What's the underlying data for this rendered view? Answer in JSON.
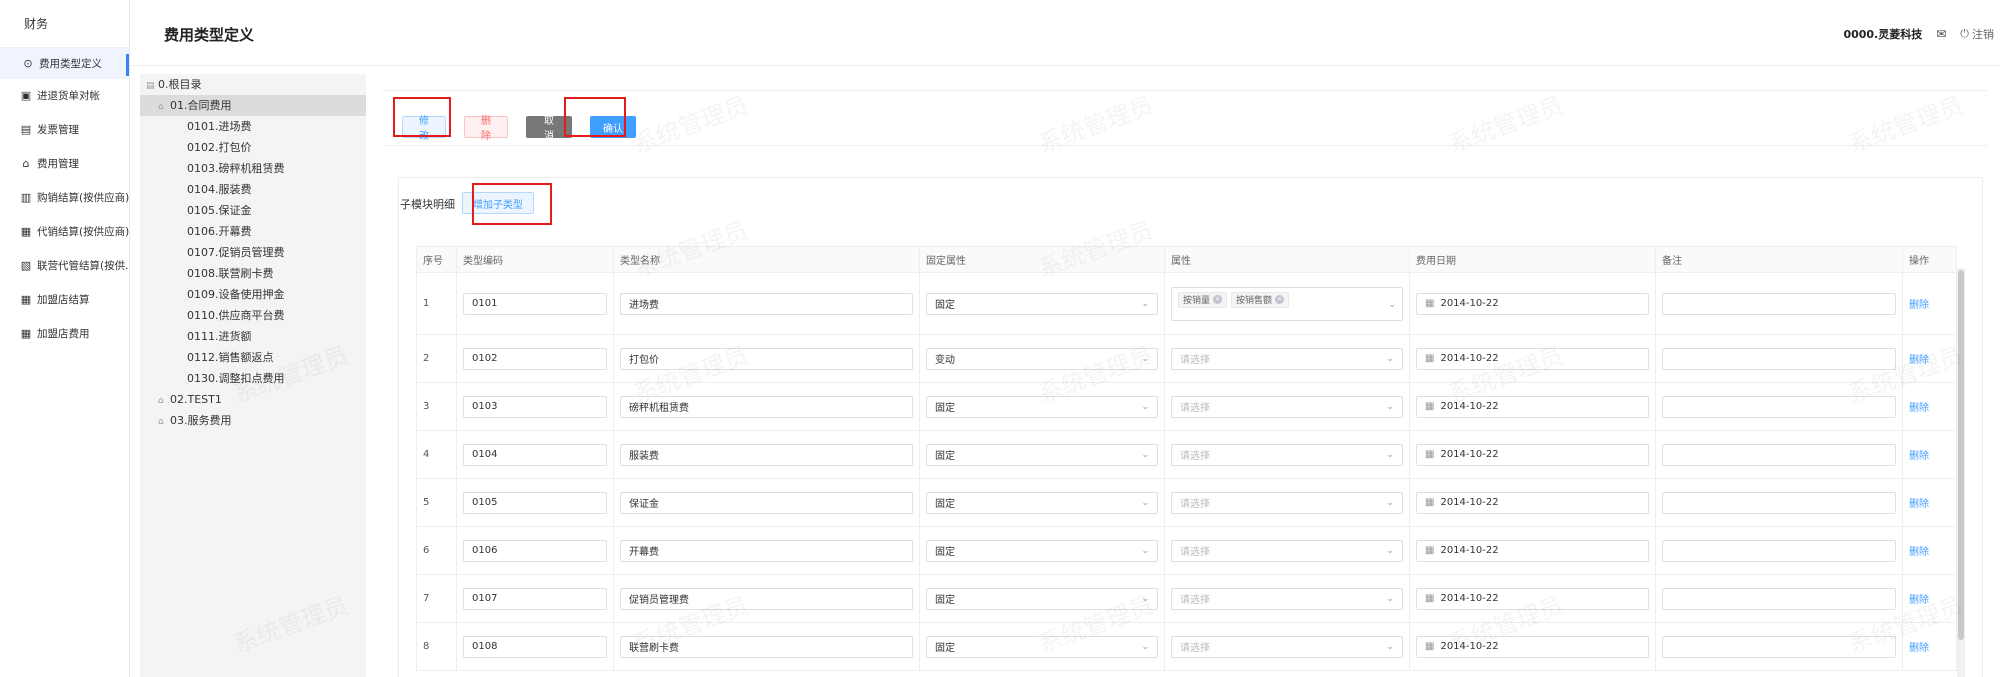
{
  "nav": {
    "title": "财务",
    "items": [
      {
        "label": "费用类型定义",
        "icon": "circle-icon"
      },
      {
        "label": "进退货单对帐",
        "icon": "calendar-icon"
      },
      {
        "label": "发票管理",
        "icon": "invoice-icon"
      },
      {
        "label": "费用管理",
        "icon": "home-icon"
      },
      {
        "label": "购销结算(按供应商)",
        "icon": "bar-chart-icon"
      },
      {
        "label": "代销结算(按供应商)",
        "icon": "grid-icon"
      },
      {
        "label": "联营代管结算(按供...",
        "icon": "document-icon"
      },
      {
        "label": "加盟店结算",
        "icon": "grid-icon"
      },
      {
        "label": "加盟店费用",
        "icon": "grid-icon"
      }
    ]
  },
  "header": {
    "title": "费用类型定义",
    "company": "0000.灵菱科技",
    "logout": "注销"
  },
  "tree": [
    {
      "label": "0.根目录",
      "level": 0,
      "selected": false
    },
    {
      "label": "01.合同费用",
      "level": 1,
      "selected": true
    },
    {
      "label": "0101.进场费",
      "level": 2,
      "selected": false
    },
    {
      "label": "0102.打包价",
      "level": 2,
      "selected": false
    },
    {
      "label": "0103.磅秤机租赁费",
      "level": 2,
      "selected": false
    },
    {
      "label": "0104.服装费",
      "level": 2,
      "selected": false
    },
    {
      "label": "0105.保证金",
      "level": 2,
      "selected": false
    },
    {
      "label": "0106.开幕费",
      "level": 2,
      "selected": false
    },
    {
      "label": "0107.促销员管理费",
      "level": 2,
      "selected": false
    },
    {
      "label": "0108.联营刷卡费",
      "level": 2,
      "selected": false
    },
    {
      "label": "0109.设备使用押金",
      "level": 2,
      "selected": false
    },
    {
      "label": "0110.供应商平台费",
      "level": 2,
      "selected": false
    },
    {
      "label": "0111.进货额",
      "level": 2,
      "selected": false
    },
    {
      "label": "0112.销售额返点",
      "level": 2,
      "selected": false
    },
    {
      "label": "0130.调整扣点费用",
      "level": 2,
      "selected": false
    },
    {
      "label": "02.TEST1",
      "level": 1,
      "selected": false
    },
    {
      "label": "03.服务费用",
      "level": 1,
      "selected": false
    }
  ],
  "toolbar": {
    "edit": "修改",
    "delete": "删除",
    "cancel": "取 消",
    "confirm": "确认"
  },
  "sub": {
    "label": "子模块明细",
    "add_button": "增加子类型"
  },
  "table": {
    "headers": [
      "序号",
      "类型编码",
      "类型名称",
      "固定属性",
      "属性",
      "费用日期",
      "备注",
      "操作"
    ],
    "select_placeholder": "请选择",
    "delete_link": "删除",
    "rows": [
      {
        "no": "1",
        "code": "0101",
        "name": "进场费",
        "fixed": "固定",
        "tags": [
          "按销量",
          "按销售额"
        ],
        "date": "2014-10-22",
        "remark": ""
      },
      {
        "no": "2",
        "code": "0102",
        "name": "打包价",
        "fixed": "变动",
        "tags": [],
        "date": "2014-10-22",
        "remark": ""
      },
      {
        "no": "3",
        "code": "0103",
        "name": "磅秤机租赁费",
        "fixed": "固定",
        "tags": [],
        "date": "2014-10-22",
        "remark": ""
      },
      {
        "no": "4",
        "code": "0104",
        "name": "服装费",
        "fixed": "固定",
        "tags": [],
        "date": "2014-10-22",
        "remark": ""
      },
      {
        "no": "5",
        "code": "0105",
        "name": "保证金",
        "fixed": "固定",
        "tags": [],
        "date": "2014-10-22",
        "remark": ""
      },
      {
        "no": "6",
        "code": "0106",
        "name": "开幕费",
        "fixed": "固定",
        "tags": [],
        "date": "2014-10-22",
        "remark": ""
      },
      {
        "no": "7",
        "code": "0107",
        "name": "促销员管理费",
        "fixed": "固定",
        "tags": [],
        "date": "2014-10-22",
        "remark": ""
      },
      {
        "no": "8",
        "code": "0108",
        "name": "联营刷卡费",
        "fixed": "固定",
        "tags": [],
        "date": "2014-10-22",
        "remark": ""
      }
    ]
  },
  "watermark": "系统管理员"
}
